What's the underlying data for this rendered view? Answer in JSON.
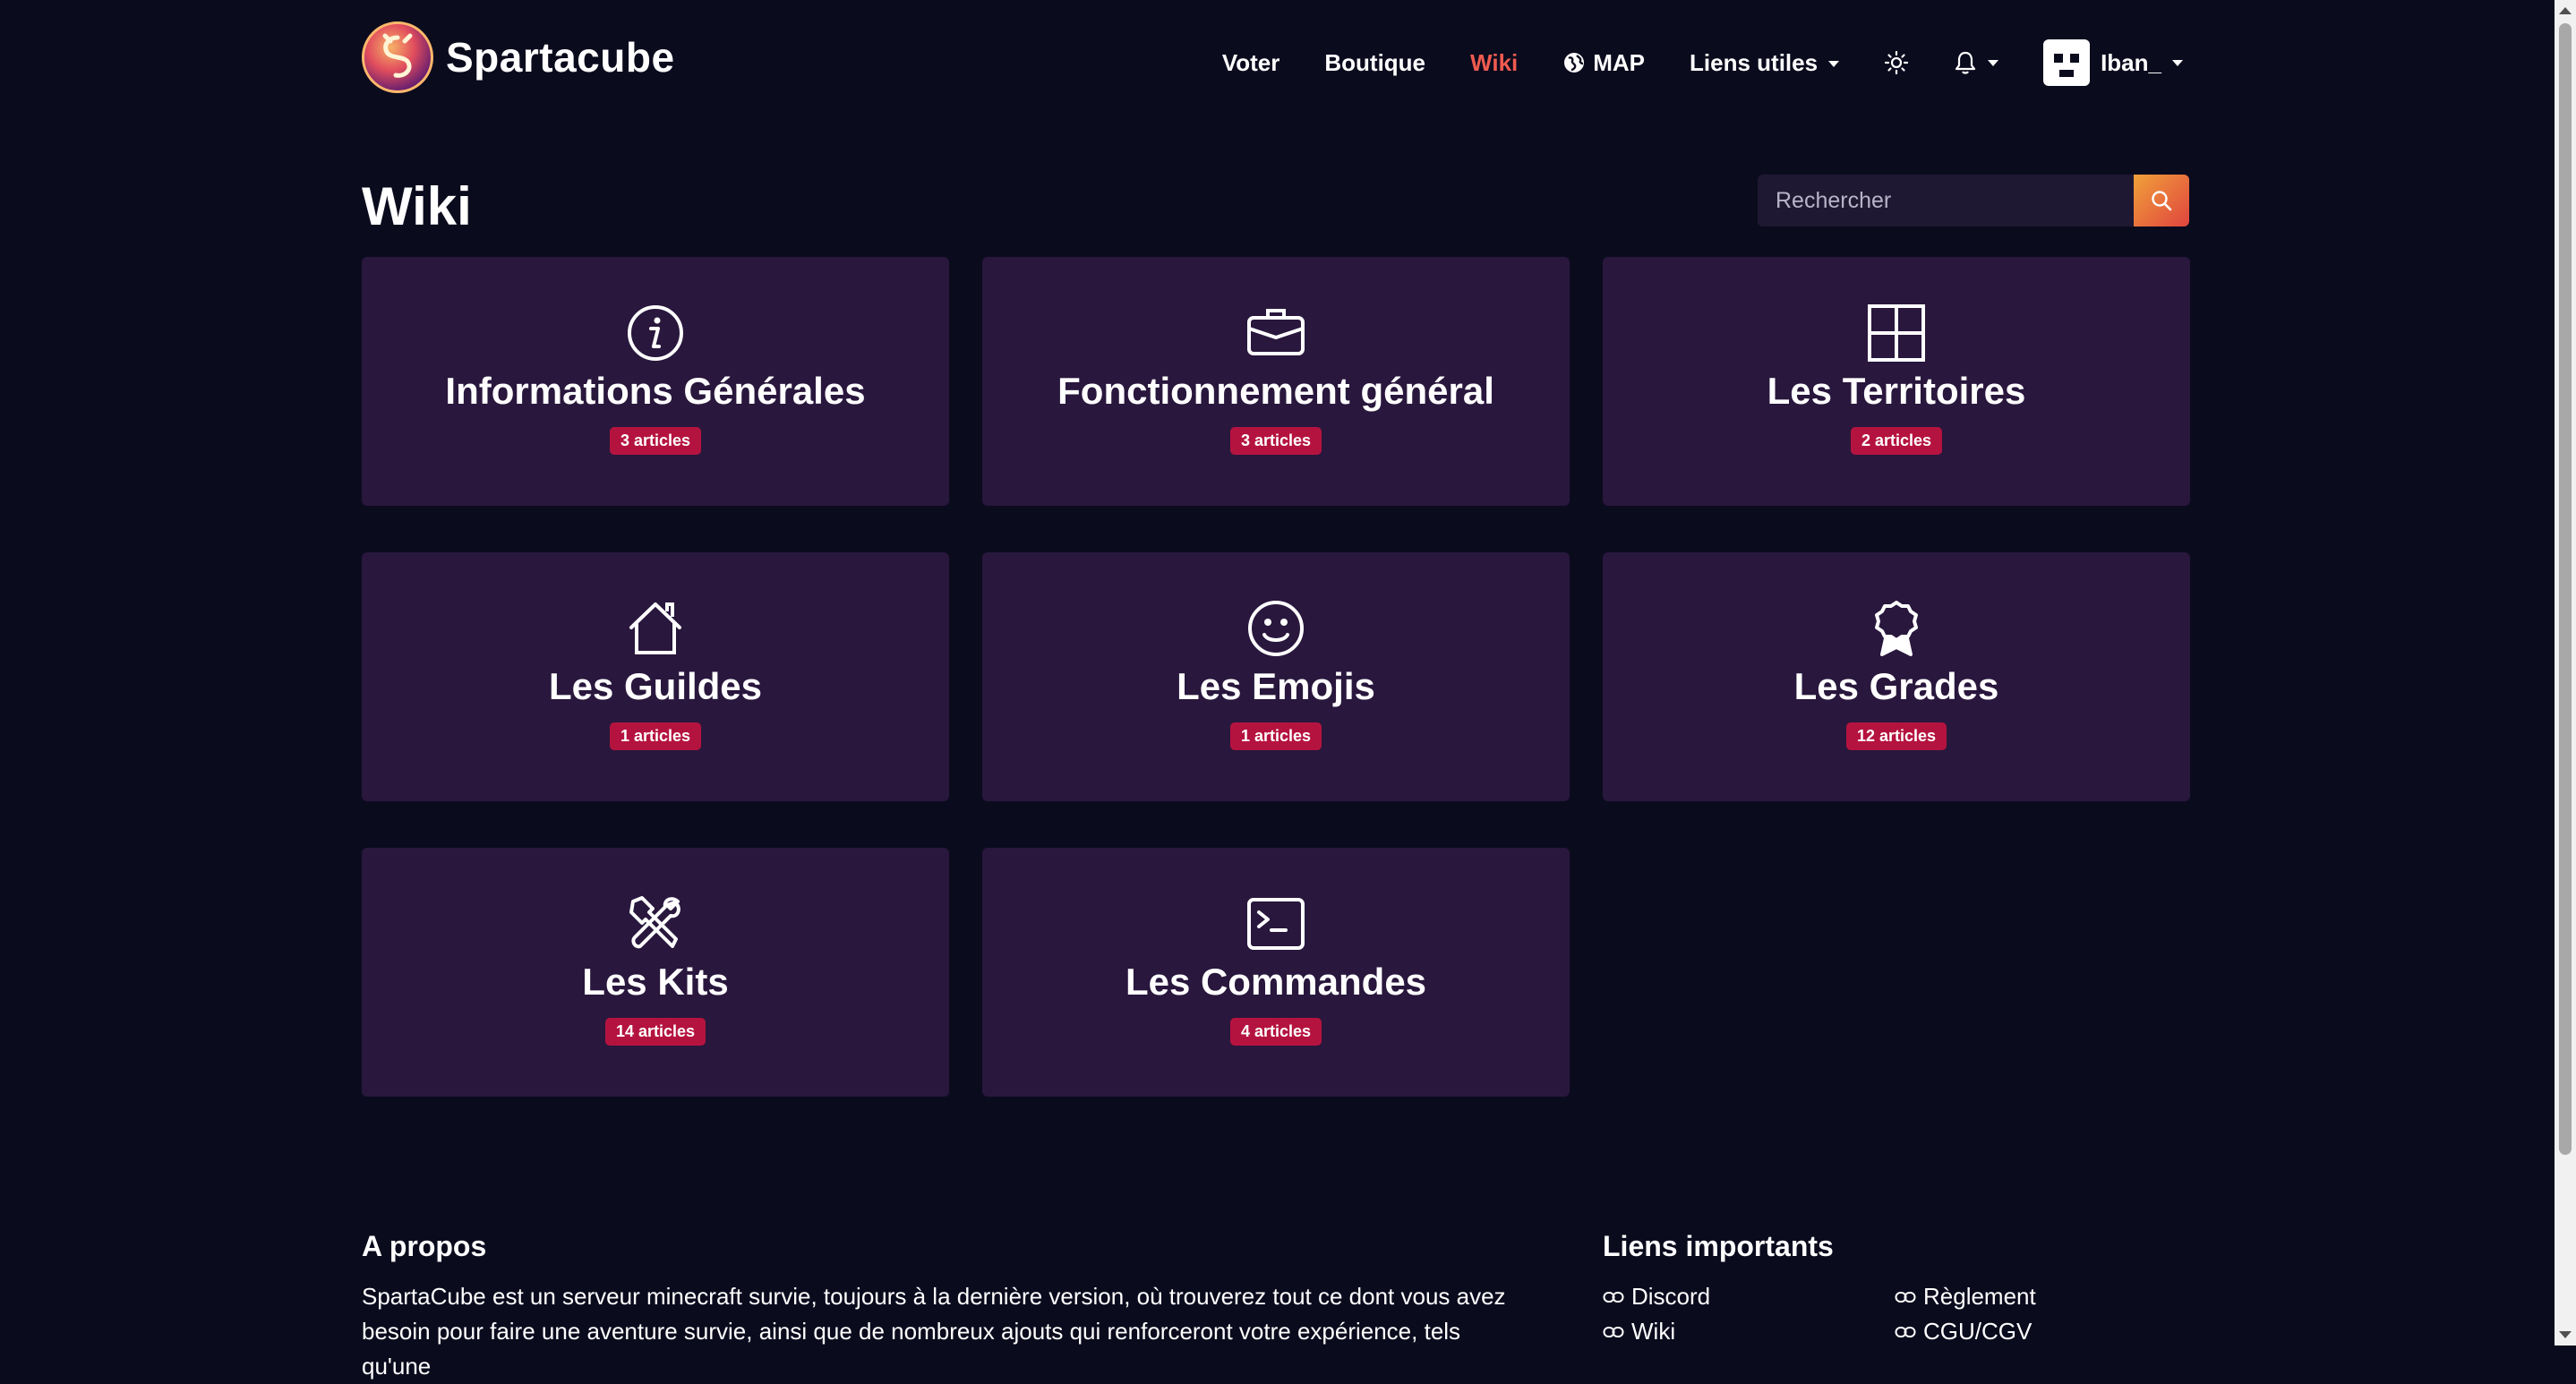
{
  "brand": {
    "name": "Spartacube",
    "logo_icon": "spartacube-logo"
  },
  "nav": {
    "items": [
      {
        "label": "Voter"
      },
      {
        "label": "Boutique"
      },
      {
        "label": "Wiki",
        "active": true
      },
      {
        "label": "MAP",
        "icon": "globe-icon"
      },
      {
        "label": "Liens utiles",
        "icon": "caret-down-icon"
      }
    ],
    "theme_icon": "sun-icon",
    "notifications_icon": "bell-icon",
    "user": {
      "name": "Iban_"
    }
  },
  "page": {
    "title": "Wiki"
  },
  "search": {
    "placeholder": "Rechercher",
    "button_icon": "search-icon"
  },
  "colors": {
    "background": "#0b0b1e",
    "card": "#29173d",
    "badge": "#b5133f",
    "active_nav": "#ef5b4f",
    "search_button": "#f0a13a"
  },
  "categories": [
    {
      "title": "Informations Générales",
      "badge": "3 articles",
      "icon": "info-circle-icon"
    },
    {
      "title": "Fonctionnement général",
      "badge": "3 articles",
      "icon": "briefcase-icon"
    },
    {
      "title": "Les Territoires",
      "badge": "2 articles",
      "icon": "grid-icon"
    },
    {
      "title": "Les Guildes",
      "badge": "1 articles",
      "icon": "house-icon"
    },
    {
      "title": "Les Emojis",
      "badge": "1 articles",
      "icon": "smiley-icon"
    },
    {
      "title": "Les Grades",
      "badge": "12 articles",
      "icon": "award-icon"
    },
    {
      "title": "Les Kits",
      "badge": "14 articles",
      "icon": "tools-icon"
    },
    {
      "title": "Les Commandes",
      "badge": "4 articles",
      "icon": "terminal-icon"
    }
  ],
  "footer": {
    "about": {
      "heading": "A propos",
      "text": "SpartaCube est un serveur minecraft survie, toujours à la dernière version, où trouverez tout ce dont vous avez besoin pour faire une aventure survie, ainsi que de nombreux ajouts qui renforceront votre expérience, tels qu'une"
    },
    "links": {
      "heading": "Liens importants",
      "items": [
        {
          "label": "Discord"
        },
        {
          "label": "Règlement"
        },
        {
          "label": "Wiki"
        },
        {
          "label": "CGU/CGV"
        }
      ]
    }
  }
}
